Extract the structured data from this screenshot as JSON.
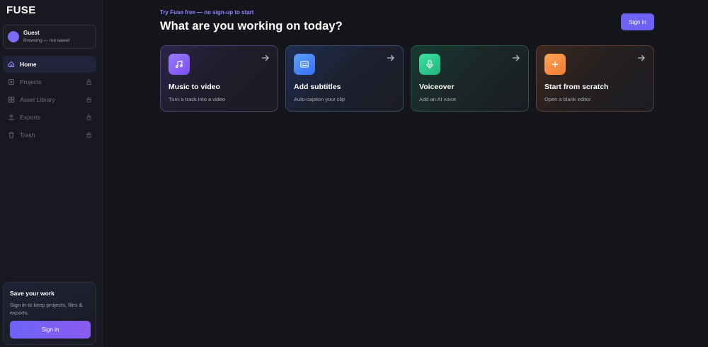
{
  "app": {
    "logo": "FUSE"
  },
  "sidebar": {
    "user": {
      "name": "Guest",
      "status": "Browsing — not saved"
    },
    "items": [
      {
        "label": "Home",
        "icon": "home-icon",
        "active": true,
        "locked": false
      },
      {
        "label": "Projects",
        "icon": "projects-icon",
        "active": false,
        "locked": true
      },
      {
        "label": "Asset Library",
        "icon": "grid-icon",
        "active": false,
        "locked": true
      },
      {
        "label": "Exports",
        "icon": "upload-icon",
        "active": false,
        "locked": true
      },
      {
        "label": "Trash",
        "icon": "trash-icon",
        "active": false,
        "locked": true
      }
    ],
    "save_card": {
      "title": "Save your work",
      "text": "Sign in to keep projects, files & exports.",
      "button": "Sign in"
    }
  },
  "main": {
    "promo": "Try Fuse free — no sign-up to start",
    "heading": "What are you working on today?",
    "signin": "Sign in",
    "cards": [
      {
        "title": "Music to video",
        "subtitle": "Turn a track into a video",
        "icon": "music-note-icon",
        "accent": "#8b5cf6"
      },
      {
        "title": "Add subtitles",
        "subtitle": "Auto-caption your clip",
        "icon": "captions-icon",
        "accent": "#3b82f6"
      },
      {
        "title": "Voiceover",
        "subtitle": "Add an AI voice",
        "icon": "microphone-icon",
        "accent": "#22c58b"
      },
      {
        "title": "Start from scratch",
        "subtitle": "Open a blank editor",
        "icon": "plus-icon",
        "accent": "#f5873a"
      }
    ]
  },
  "colors": {
    "accent": "#6d62f4",
    "background": "#15161c",
    "sidebar": "#181920"
  }
}
